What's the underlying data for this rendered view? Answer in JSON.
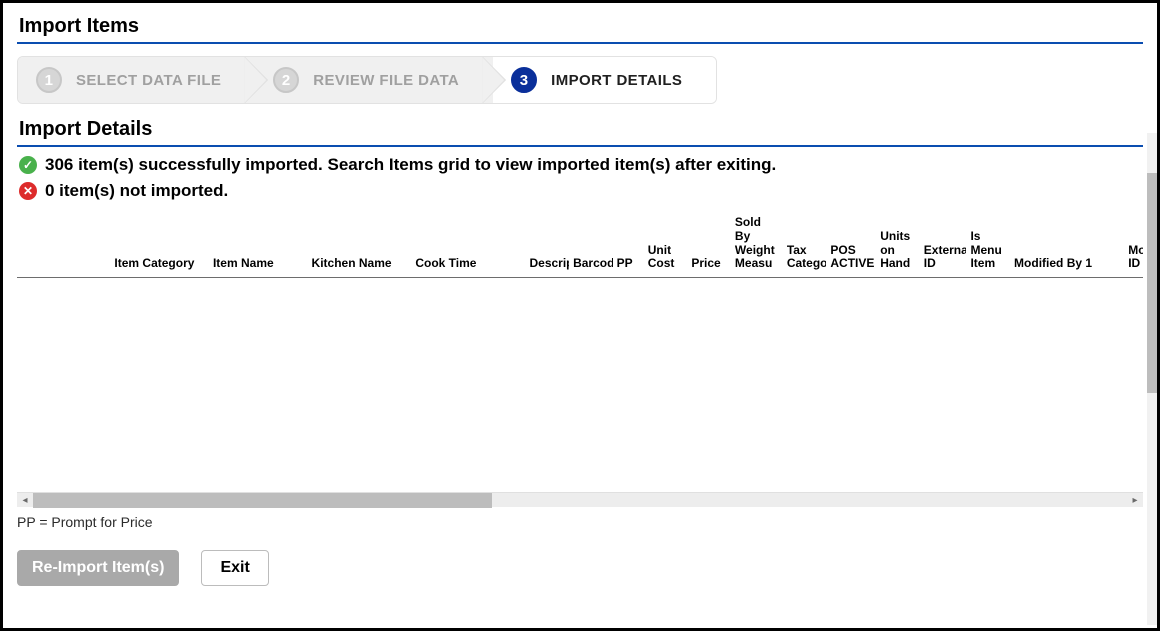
{
  "page": {
    "title": "Import Items",
    "section_title": "Import Details"
  },
  "wizard": {
    "steps": [
      {
        "num": "1",
        "label": "SELECT DATA FILE",
        "active": false
      },
      {
        "num": "2",
        "label": "REVIEW FILE DATA",
        "active": false
      },
      {
        "num": "3",
        "label": "IMPORT DETAILS",
        "active": true
      }
    ]
  },
  "status": {
    "success_count": 306,
    "success_text": "306 item(s) successfully imported. Search Items grid to view imported item(s) after exiting.",
    "fail_count": 0,
    "fail_text": "0 item(s) not imported."
  },
  "grid": {
    "columns": [
      "",
      "Item Category",
      "Item Name",
      "Kitchen Name",
      "Cook Time",
      "Descrip",
      "Barcod",
      "PP",
      "Unit Cost",
      "Price",
      "Sold By Weight Measu",
      "Tax Catego",
      "POS ACTIVE",
      "Units on Hand",
      "Externa ID",
      "Is Menu Item",
      "Modified By 1",
      "Modifier G ID"
    ],
    "rows": []
  },
  "footnote": "PP = Prompt for Price",
  "buttons": {
    "reimport": "Re-Import Item(s)",
    "exit": "Exit"
  },
  "icons": {
    "check": "✓",
    "cross": "✕",
    "left": "◂",
    "right": "▸"
  }
}
